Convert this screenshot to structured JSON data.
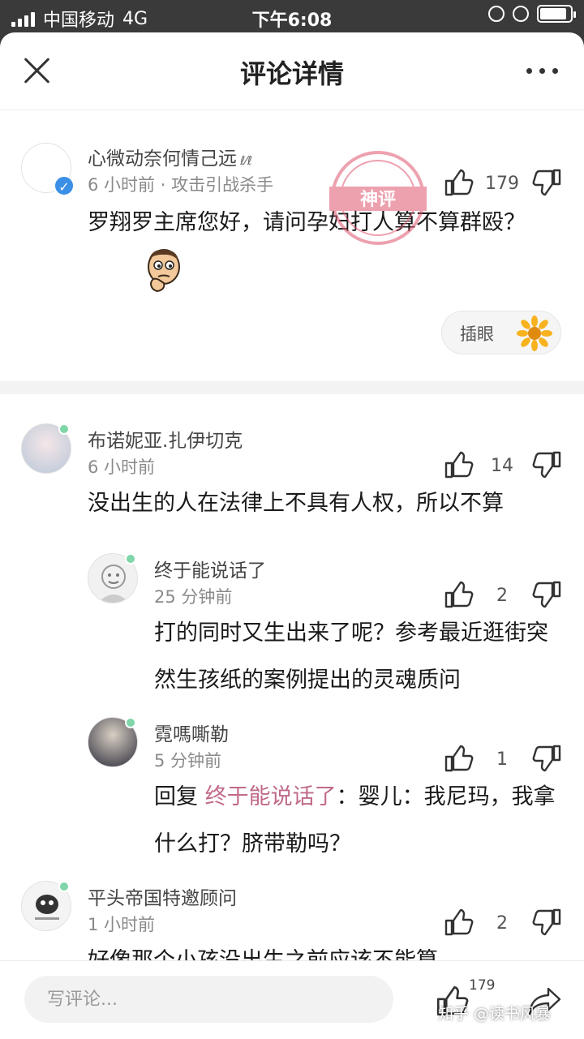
{
  "status_bar": {
    "carrier": "中国移动",
    "network": "4G",
    "time": "下午6:08",
    "battery_level": 0.9
  },
  "header": {
    "title": "评论详情"
  },
  "stamp_text": "神评",
  "main_comment": {
    "author": "心微动奈何情己远",
    "author_suffix": "ℓ⁄ℓ",
    "time": "6 小时前",
    "separator": "·",
    "tag": "攻击引战杀手",
    "text": "罗翔罗主席您好，请问孕妇打人算不算群殴？",
    "likes": "179",
    "action_label": "插眼"
  },
  "replies": [
    {
      "author": "布诺妮亚.扎伊切克",
      "time": "6 小时前",
      "text": "没出生的人在法律上不具有人权，所以不算",
      "likes": "14"
    },
    {
      "author": "终于能说话了",
      "time": "25 分钟前",
      "text": "打的同时又生出来了呢？参考最近逛街突然生孩纸的案例提出的灵魂质问",
      "likes": "2"
    },
    {
      "author": "霓嗎嘶勒",
      "time": "5 分钟前",
      "reply_prefix": "回复",
      "reply_to": "终于能说话了",
      "reply_colon": "：",
      "text": "婴儿：我尼玛，我拿什么打？脐带勒吗？",
      "likes": "1"
    },
    {
      "author": "平头帝国特邀顾问",
      "time": "1 小时前",
      "text": "好像那个小孩没出生之前应该不能算",
      "likes": "2"
    }
  ],
  "bottom_bar": {
    "input_placeholder": "写评论...",
    "like_count": "179",
    "watermark": "知乎 @读书风暴"
  },
  "colors": {
    "accent_mention": "#c06a8a",
    "online_dot": "#7fd6a8",
    "verified": "#3b8fe6",
    "stamp": "#e0566e"
  }
}
